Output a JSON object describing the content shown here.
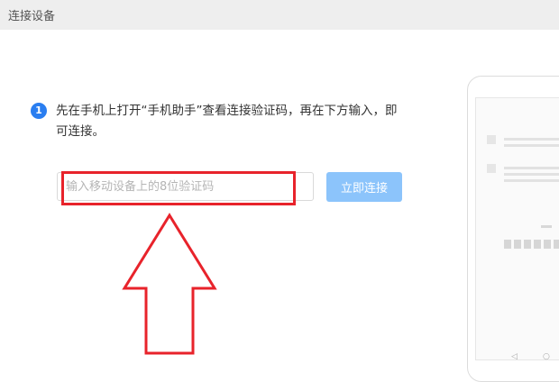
{
  "window": {
    "title": "连接设备"
  },
  "step": {
    "number": "1",
    "text": "先在手机上打开“手机助手”查看连接验证码，再在下方输入，即可连接。"
  },
  "code_input": {
    "placeholder": "输入移动设备上的8位验证码",
    "value": ""
  },
  "connect_button": {
    "label": "立即连接"
  },
  "phone_nav": {
    "back": "◁",
    "home": "○"
  },
  "colors": {
    "accent": "#2a7ef0",
    "button": "#8cc4fb",
    "highlight": "#e8232b"
  }
}
